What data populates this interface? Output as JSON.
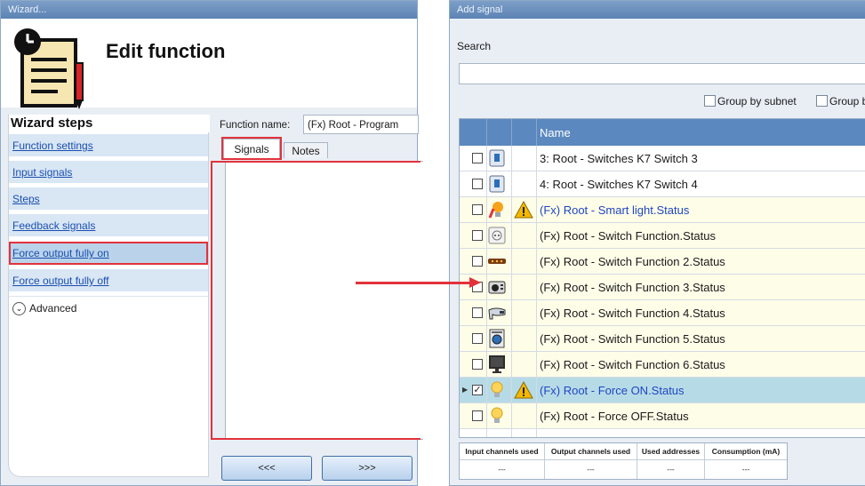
{
  "left_window": {
    "title": "Wizard...",
    "header_title": "Edit function",
    "wizard_steps_title": "Wizard steps",
    "steps": [
      {
        "label": "Function settings"
      },
      {
        "label": "Input signals"
      },
      {
        "label": "Steps"
      },
      {
        "label": "Feedback signals"
      },
      {
        "label": "Force output fully on",
        "active": true
      },
      {
        "label": "Force output fully off"
      }
    ],
    "advanced_label": "Advanced",
    "function_name_label": "Function name:",
    "function_name_value": "(Fx) Root - Program",
    "tabs": [
      "Signals",
      "Notes"
    ],
    "buttons": {
      "back": "<<<",
      "next": ">>>"
    }
  },
  "right_window": {
    "title": "Add signal",
    "search_label": "Search",
    "search_value": "",
    "group_by_subnet": "Group by subnet",
    "group_partial": "Group b",
    "column_name": "Name",
    "rows": [
      {
        "name": "3: Root - Switches K7 Switch 3",
        "icon1": "switch-module-icon",
        "checked": false
      },
      {
        "name": "4: Root - Switches K7 Switch 4",
        "icon1": "switch-module-icon",
        "checked": false
      },
      {
        "name": "(Fx) Root - Smart light.Status",
        "icon1": "smart-light-bulb-icon",
        "icon2": "warning-icon",
        "checked": false
      },
      {
        "name": "(Fx) Root - Switch Function.Status",
        "icon1": "wall-socket-icon",
        "checked": false
      },
      {
        "name": "(Fx) Root - Switch Function 2.Status",
        "icon1": "heater-strip-icon",
        "checked": false
      },
      {
        "name": "(Fx) Root - Switch Function 3.Status",
        "icon1": "oven-icon",
        "checked": false
      },
      {
        "name": "(Fx) Root - Switch Function 4.Status",
        "icon1": "hair-dryer-icon",
        "checked": false
      },
      {
        "name": "(Fx) Root - Switch Function 5.Status",
        "icon1": "washing-machine-icon",
        "checked": false
      },
      {
        "name": "(Fx) Root - Switch Function 6.Status",
        "icon1": "monitor-icon",
        "checked": false
      },
      {
        "name": "(Fx) Root - Force ON.Status",
        "icon1": "light-bulb-icon",
        "icon2": "warning-icon",
        "checked": true
      },
      {
        "name": "(Fx) Root - Force OFF.Status",
        "icon1": "light-bulb-icon",
        "checked": false
      }
    ],
    "footer": {
      "headers": [
        "Input channels used",
        "Output channels used",
        "Used addresses",
        "Consumption (mA)"
      ],
      "values": [
        "---",
        "---",
        "---",
        "---"
      ]
    }
  },
  "colors": {
    "highlight_red": "#e2323b",
    "grid_header_blue": "#5b88bf",
    "selected_row": "#b7dbe6",
    "status_row_yellow": "#fefde8",
    "link_blue": "#1a4fb0"
  }
}
